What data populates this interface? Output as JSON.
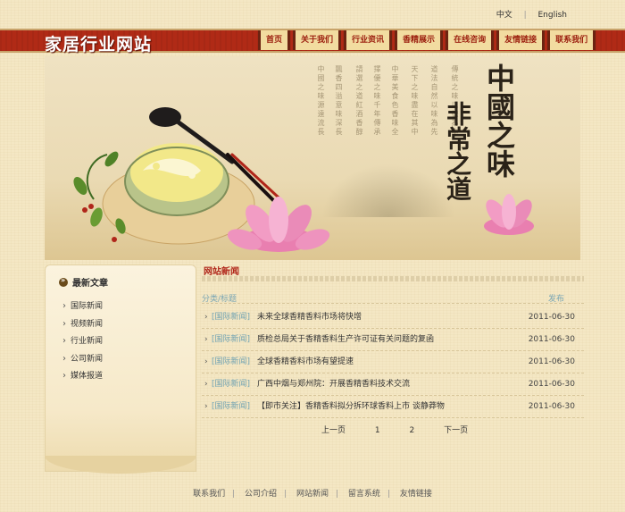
{
  "lang": {
    "zh": "中文",
    "sep": "|",
    "en": "English"
  },
  "site_title": "家居行业网站",
  "nav": [
    "首页",
    "关于我们",
    "行业资讯",
    "香精展示",
    "在线咨询",
    "友情链接",
    "联系我们"
  ],
  "banner": {
    "calligraphy_1": "中國之味",
    "calligraphy_2": "非常之道"
  },
  "sidebar": {
    "title": "最新文章",
    "items": [
      "国际新闻",
      "视频新闻",
      "行业新闻",
      "公司新闻",
      "媒体报道"
    ]
  },
  "news": {
    "heading": "网站新闻",
    "col_category_title": "分类/标题",
    "col_date": "发布",
    "rows": [
      {
        "category": "[国际新闻]",
        "title": "未来全球香精香料市场将快增",
        "date": "2011-06-30"
      },
      {
        "category": "[国际新闻]",
        "title": "质检总局关于香精香料生产许可证有关问题的复函",
        "date": "2011-06-30"
      },
      {
        "category": "[国际新闻]",
        "title": "全球香精香料市场有望提速",
        "date": "2011-06-30"
      },
      {
        "category": "[国际新闻]",
        "title": "广西中烟与郑州院：开展香精香料技术交流",
        "date": "2011-06-30"
      },
      {
        "category": "[国际新闻]",
        "title": "【即市关注】香精香料拟分拆环球香料上市 谈静莽物",
        "date": "2011-06-30"
      }
    ]
  },
  "pager": {
    "prev": "上一页",
    "page1": "1",
    "page2": "2",
    "next": "下一页"
  },
  "footer": [
    "联系我们",
    "公司介绍",
    "网站新闻",
    "留言系统",
    "友情链接"
  ]
}
